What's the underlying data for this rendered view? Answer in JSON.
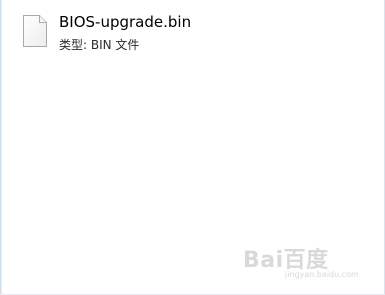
{
  "file": {
    "name": "BIOS-upgrade.bin",
    "type_label": "类型: BIN 文件",
    "icon": "blank-document-icon"
  },
  "watermark": {
    "text": "Bai百度",
    "subtext": "jingyan.baidu.com"
  }
}
